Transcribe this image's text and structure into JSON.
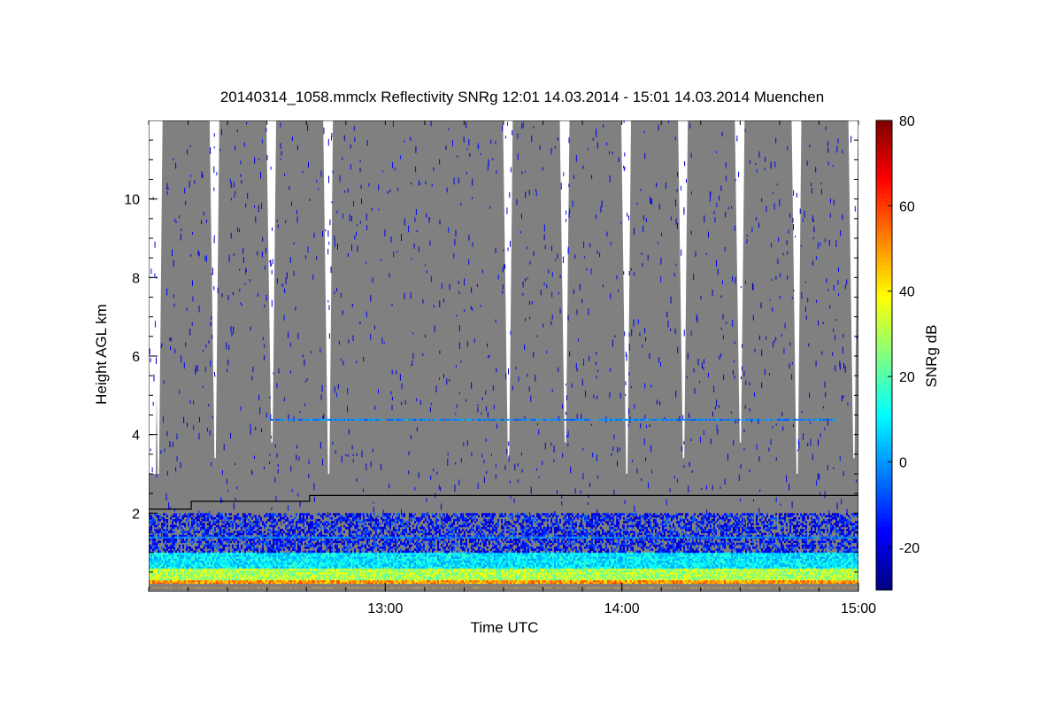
{
  "chart_data": {
    "type": "heatmap",
    "title": "20140314_1058.mmclx Reflectivity SNRg   12:01 14.03.2014 - 15:01 14.03.2014 Muenchen",
    "xlabel": "Time UTC",
    "ylabel": "Height AGL km",
    "colorbar_label": "SNRg dB",
    "x_time_range_hours": [
      12.0,
      15.0
    ],
    "x_ticks": [
      {
        "value": 13.0,
        "label": "13:00"
      },
      {
        "value": 14.0,
        "label": "14:00"
      },
      {
        "value": 15.0,
        "label": "15:00"
      }
    ],
    "y_range_km": [
      0.0,
      12.0
    ],
    "y_ticks": [
      {
        "value": 2,
        "label": "2"
      },
      {
        "value": 4,
        "label": "4"
      },
      {
        "value": 6,
        "label": "6"
      },
      {
        "value": 8,
        "label": "8"
      },
      {
        "value": 10,
        "label": "10"
      }
    ],
    "colorbar_range_db": [
      -30,
      80
    ],
    "colorbar_ticks": [
      {
        "value": -20,
        "label": "-20"
      },
      {
        "value": 0,
        "label": "0"
      },
      {
        "value": 20,
        "label": "20"
      },
      {
        "value": 40,
        "label": "40"
      },
      {
        "value": 60,
        "label": "60"
      },
      {
        "value": 80,
        "label": "80"
      }
    ],
    "colormap": [
      "#00007f",
      "#0000ff",
      "#0080ff",
      "#00ffff",
      "#80ff80",
      "#ffff00",
      "#ff8000",
      "#ff0000",
      "#7f0000"
    ],
    "noise_fill_color": "#808080",
    "scan_gaps_hours": [
      12.04,
      12.28,
      12.52,
      12.76,
      13.52,
      13.76,
      14.02,
      14.26,
      14.5,
      14.74,
      14.98
    ],
    "boundary_layer_line": [
      {
        "t": 12.0,
        "h": 2.1
      },
      {
        "t": 12.18,
        "h": 2.1
      },
      {
        "t": 12.18,
        "h": 2.3
      },
      {
        "t": 12.68,
        "h": 2.3
      },
      {
        "t": 12.68,
        "h": 2.45
      },
      {
        "t": 15.0,
        "h": 2.45
      }
    ],
    "blue_echo_layers_km": [
      {
        "t0": 12.0,
        "t1": 15.0,
        "h": 1.4
      },
      {
        "t0": 12.5,
        "t1": 14.9,
        "h": 4.4
      }
    ]
  }
}
